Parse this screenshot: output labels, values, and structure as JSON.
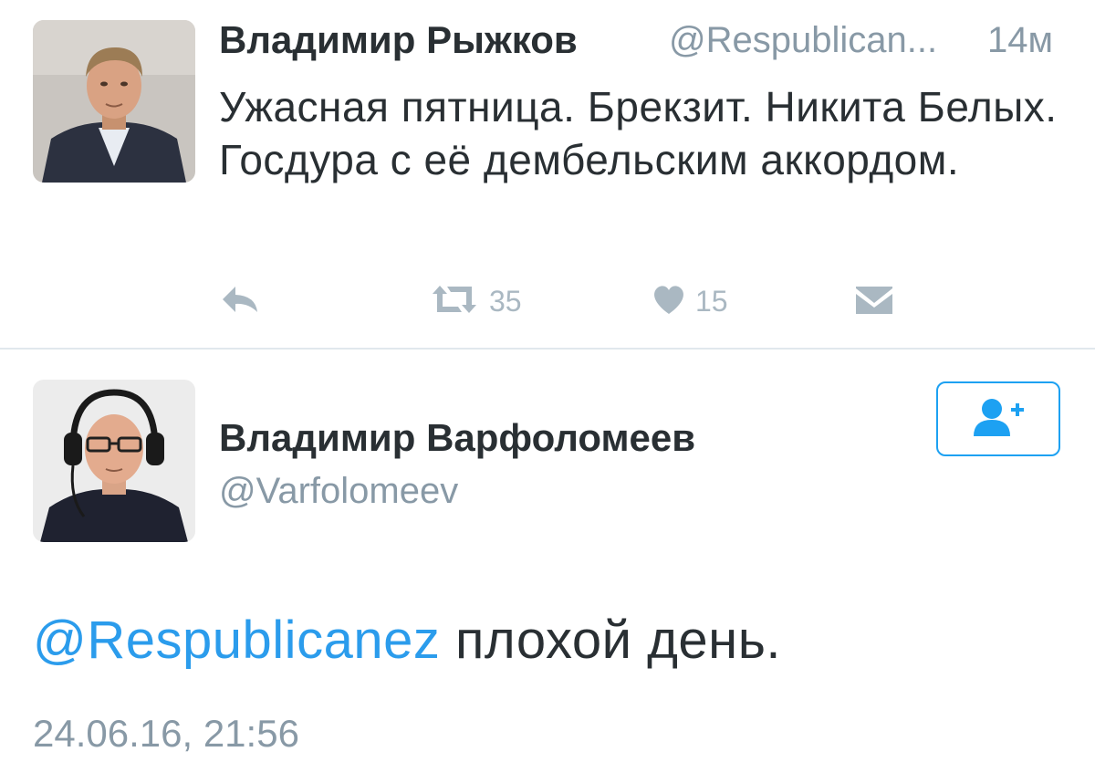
{
  "tweet1": {
    "author_name": "Владимир Рыжков",
    "author_handle": "@Respublican...",
    "time": "14м",
    "text": "Ужасная пятница. Брекзит. Никита Белых. Госдура с её дембельским аккордом.",
    "actions": {
      "reply_icon": "reply-icon",
      "retweet_icon": "retweet-icon",
      "retweet_count": "35",
      "like_icon": "heart-icon",
      "like_count": "15",
      "dm_icon": "envelope-icon"
    }
  },
  "tweet2": {
    "author_name": "Владимир Варфоломеев",
    "author_handle": "@Varfolomeev",
    "follow_icon": "add-user-icon",
    "mention": "@Respublicanez",
    "text": " плохой день.",
    "timestamp": "24.06.16, 21:56"
  },
  "colors": {
    "accent": "#1da1f2",
    "mention": "#2b9cec",
    "muted": "#8899a6",
    "icon": "#aab8c2",
    "text": "#292f33",
    "divider": "#e1e8ed"
  }
}
